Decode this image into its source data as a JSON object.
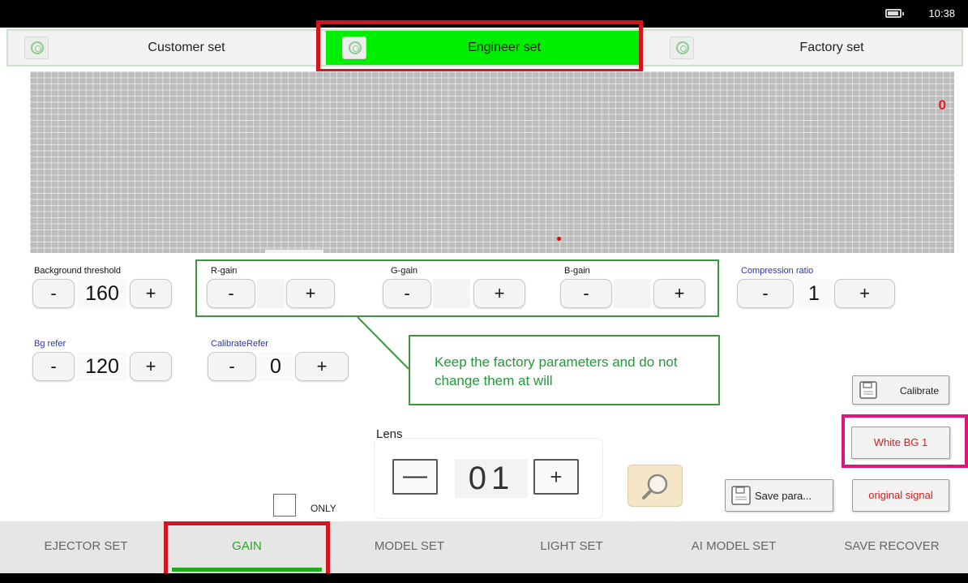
{
  "status_bar": {
    "time": "10:38"
  },
  "top_tabs": [
    {
      "label": "Customer set",
      "active": false
    },
    {
      "label": "Engineer set",
      "active": true
    },
    {
      "label": "Factory set",
      "active": false
    }
  ],
  "display": {
    "value": "0"
  },
  "params": {
    "background_threshold": {
      "label": "Background threshold",
      "value": "160"
    },
    "r_gain": {
      "label": "R-gain"
    },
    "g_gain": {
      "label": "G-gain"
    },
    "b_gain": {
      "label": "B-gain"
    },
    "compression_ratio": {
      "label": "Compression ratio",
      "value": "1"
    },
    "bg_refer": {
      "label": "Bg refer",
      "value": "120"
    },
    "calibrate_refer": {
      "label": "CalibrateRefer",
      "value": "0"
    },
    "minus": "-",
    "plus": "+"
  },
  "callout": "Keep the factory parameters and do not change them at will",
  "buttons": {
    "calibrate": "Calibrate",
    "white_bg": "White BG 1",
    "save_para": "Save para...",
    "original_signal": "original signal"
  },
  "only_checkbox": {
    "label": "ONLY",
    "checked": false
  },
  "lens": {
    "label": "Lens",
    "value": "01",
    "minus": "—",
    "plus": "+"
  },
  "bottom_tabs": [
    {
      "label": "EJECTOR SET",
      "active": false
    },
    {
      "label": "GAIN",
      "active": true
    },
    {
      "label": "MODEL SET",
      "active": false
    },
    {
      "label": "LIGHT SET",
      "active": false
    },
    {
      "label": "AI MODEL SET",
      "active": false
    },
    {
      "label": "SAVE RECOVER",
      "active": false
    }
  ],
  "colors": {
    "active_tab": "#00ee00",
    "highlight_red": "#d4151d",
    "highlight_pink": "#e0157a",
    "callout_green": "#22993a",
    "active_bottom_text": "#22aa22"
  }
}
